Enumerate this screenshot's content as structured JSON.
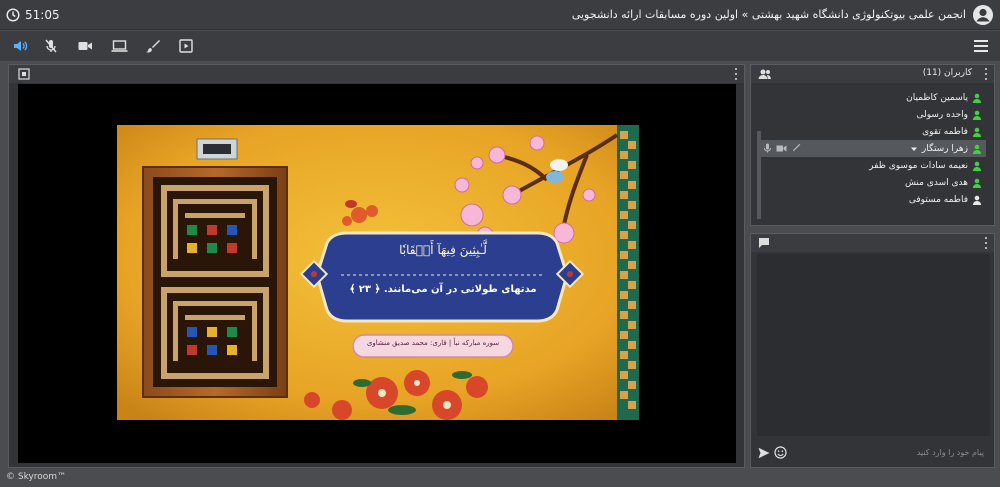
{
  "topbar": {
    "time": "51:05",
    "title": "انجمن علمی بیوتکنولوژی دانشگاه شهید بهشتی » اولین دوره مسابقات ارائه دانشجویی"
  },
  "toolbar": {
    "icons": [
      "speaker-icon",
      "mic-muted-icon",
      "camera-icon",
      "screen-share-icon",
      "brush-icon",
      "play-media-icon"
    ]
  },
  "slide": {
    "arabic_verse": "لَّـٰبِثِينَ فِيهَآ أَحۡقَابٗا",
    "verse_number": "۲۳",
    "translation": "مدتهای طولانی در آن می‌مانند. ﴿ ۲۳ ﴾",
    "reciter": "سوره مبارکه نبأ | قاری: محمد صدیق منشاوی"
  },
  "users": {
    "title": "کاربران (11)",
    "items": [
      {
        "name": "یاسمین کاظمیان",
        "active": false
      },
      {
        "name": "واحده رسولی",
        "active": false
      },
      {
        "name": "فاطمه تقوی",
        "active": false
      },
      {
        "name": "زهرا رستگار",
        "active": true
      },
      {
        "name": "نعیمه سادات موسوی ظفر",
        "active": false
      },
      {
        "name": "هدی اسدی منش",
        "active": false
      },
      {
        "name": "فاطمه مستوفی",
        "active": false
      }
    ]
  },
  "chat": {
    "placeholder": "پیام خود را وارد کنید"
  },
  "footer": {
    "brand": "© Skyroom™"
  },
  "colors": {
    "accent_green": "#3fd13f",
    "bg_dark": "#323437",
    "slide_gold": "#e9a826",
    "slide_blue": "#2c3e8f"
  }
}
